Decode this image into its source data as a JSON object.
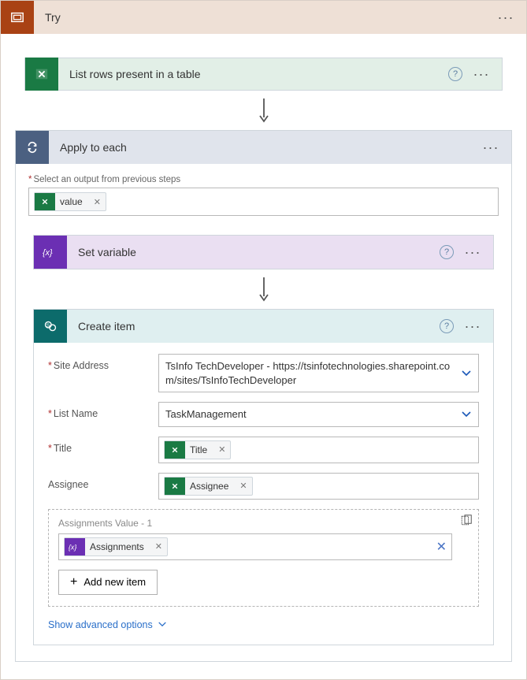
{
  "try": {
    "title": "Try"
  },
  "excel": {
    "title": "List rows present in a table"
  },
  "foreach": {
    "title": "Apply to each",
    "select_label": "Select an output from previous steps",
    "token": {
      "label": "value"
    }
  },
  "setvar": {
    "title": "Set variable"
  },
  "createitem": {
    "title": "Create item",
    "fields": {
      "site_label": "Site Address",
      "site_value": "TsInfo TechDeveloper - https://tsinfotechnologies.sharepoint.com/sites/TsInfoTechDeveloper",
      "list_label": "List Name",
      "list_value": "TaskManagement",
      "title_label": "Title",
      "title_token": "Title",
      "assignee_label": "Assignee",
      "assignee_token": "Assignee",
      "assignments_label": "Assignments Value - 1",
      "assignments_token": "Assignments"
    },
    "add_item": "Add new item",
    "advanced": "Show advanced options"
  }
}
